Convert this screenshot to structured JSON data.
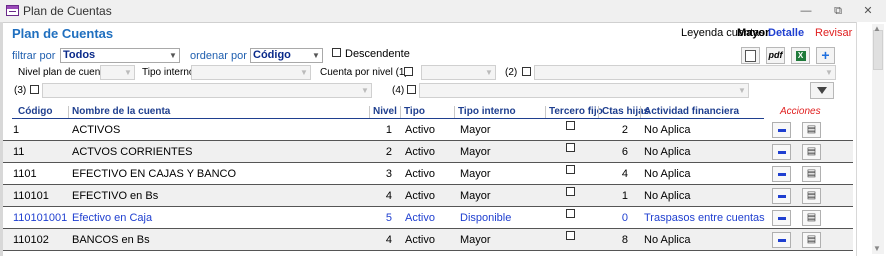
{
  "window": {
    "title": "Plan de Cuentas",
    "icon": "form-icon",
    "min": "—",
    "restore": "⧉",
    "close": "✕"
  },
  "form_title": "Plan de Cuentas",
  "legend": {
    "label": "Leyenda cuentas:",
    "mayor": "Mayor",
    "detalle": "Detalle",
    "revisar": "Revisar",
    "colors": {
      "detalle": "#1f3fd0",
      "revisar": "#e02020"
    }
  },
  "filters": {
    "filtrar_label": "filtrar por",
    "filtrar_value": "Todos",
    "ordenar_label": "ordenar por",
    "ordenar_value": "Código",
    "descendente_label": "Descendente",
    "nivel_label": "Nivel plan de cuentas",
    "nivel_value": "",
    "tipo_interno_label": "Tipo interno",
    "tipo_interno_value": "",
    "cuenta_nivel_label": "Cuenta por nivel (1)",
    "n2_label": "(2)",
    "n3_label": "(3)",
    "n4_label": "(4)"
  },
  "toolbar": {
    "preview_icon": "print-preview-icon",
    "pdf_label": "pdf",
    "excel_icon": "excel-icon",
    "add_icon": "add-icon",
    "filter_icon": "filter-icon"
  },
  "columns": {
    "codigo": "Código",
    "nombre": "Nombre de la cuenta",
    "nivel": "Nivel",
    "tipo": "Tipo",
    "tipo_interno": "Tipo interno",
    "tercero": "Tercero fijo",
    "ctas_hijas": "Ctas hijas",
    "actividad": "Actividad financiera",
    "acciones": "Acciones"
  },
  "rows": [
    {
      "codigo": "1",
      "nombre": "ACTIVOS",
      "nivel": "1",
      "tipo": "Activo",
      "tipo_interno": "Mayor",
      "ctas_hijas": "2",
      "actividad": "No Aplica",
      "kind": "mayor"
    },
    {
      "codigo": "11",
      "nombre": "ACTVOS CORRIENTES",
      "nivel": "2",
      "tipo": "Activo",
      "tipo_interno": "Mayor",
      "ctas_hijas": "6",
      "actividad": "No Aplica",
      "kind": "mayor"
    },
    {
      "codigo": "1101",
      "nombre": "EFECTIVO EN CAJAS Y BANCO",
      "nivel": "3",
      "tipo": "Activo",
      "tipo_interno": "Mayor",
      "ctas_hijas": "4",
      "actividad": "No Aplica",
      "kind": "mayor"
    },
    {
      "codigo": "110101",
      "nombre": "EFECTIVO en Bs",
      "nivel": "4",
      "tipo": "Activo",
      "tipo_interno": "Mayor",
      "ctas_hijas": "1",
      "actividad": "No Aplica",
      "kind": "mayor"
    },
    {
      "codigo": "110101001",
      "nombre": "Efectivo en Caja",
      "nivel": "5",
      "tipo": "Activo",
      "tipo_interno": "Disponible",
      "ctas_hijas": "0",
      "actividad": "Traspasos entre cuentas",
      "kind": "detalle"
    },
    {
      "codigo": "110102",
      "nombre": "BANCOS en Bs",
      "nivel": "4",
      "tipo": "Activo",
      "tipo_interno": "Mayor",
      "ctas_hijas": "8",
      "actividad": "No Aplica",
      "kind": "mayor"
    }
  ]
}
